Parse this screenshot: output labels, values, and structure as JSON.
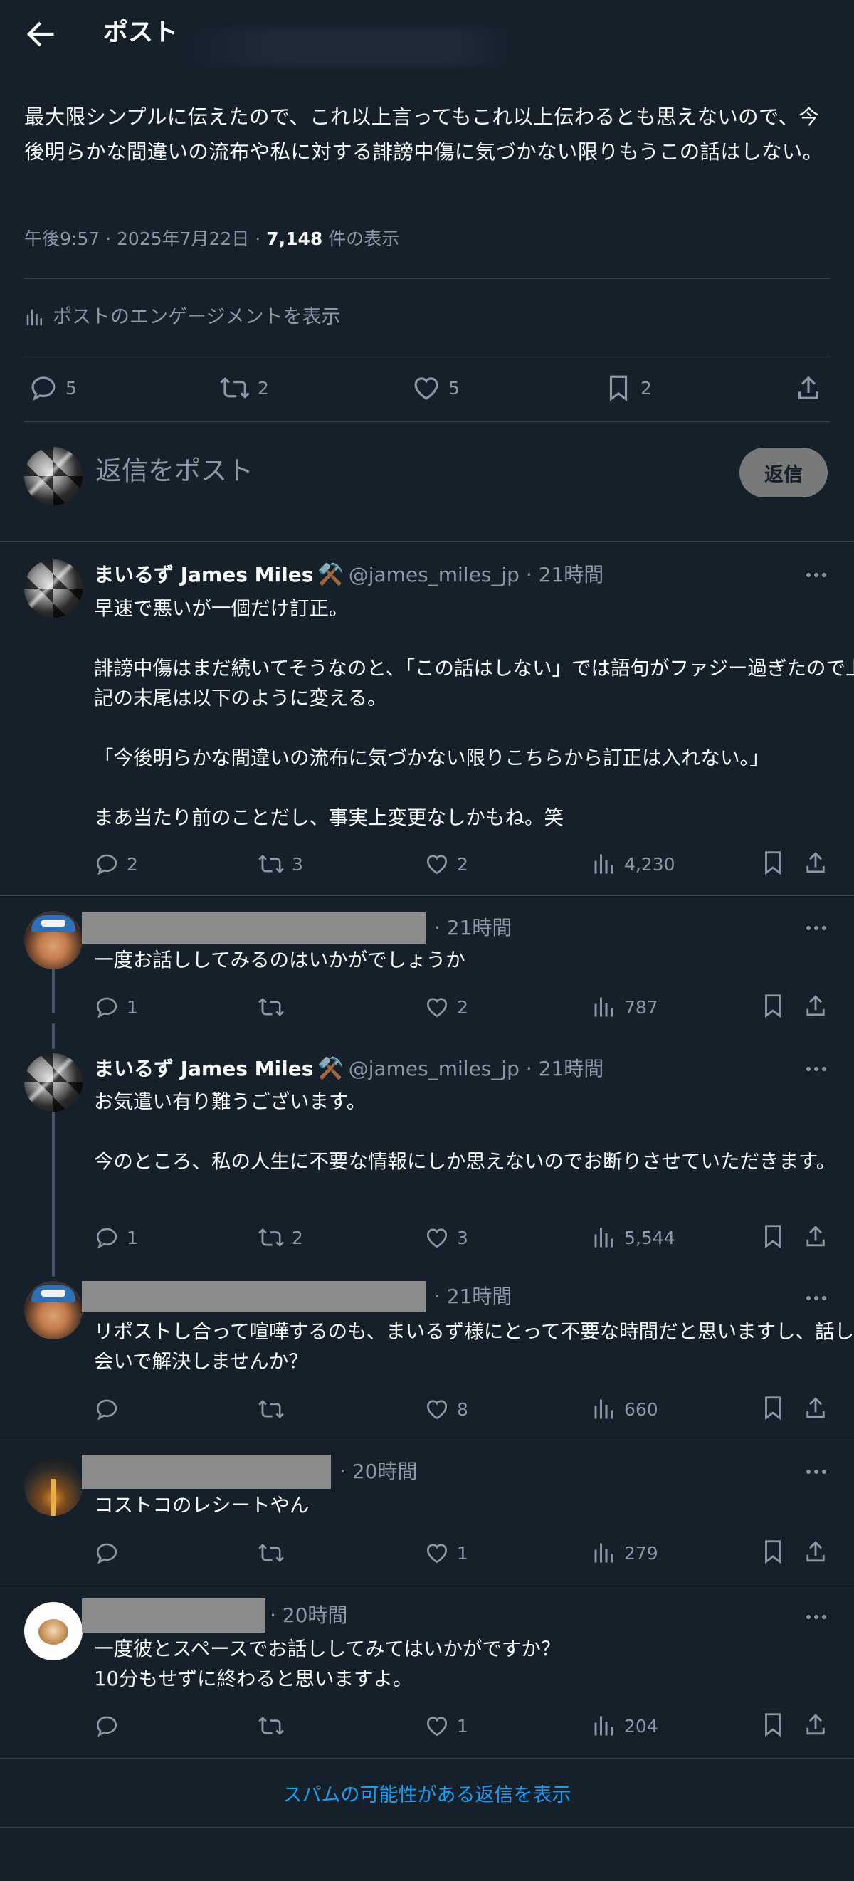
{
  "header": {
    "title": "ポスト"
  },
  "post": {
    "text": "最大限シンプルに伝えたので、これ以上言ってもこれ以上伝わるとも思えないので、今後明らかな間違いの流布や私に対する誹謗中傷に気づかない限りもうこの話はしない。",
    "time": "午後9:57 · 2025年7月22日 · ",
    "views": "7,148",
    "views_label": " 件の表示",
    "engagement_link": "ポストのエンゲージメントを表示",
    "replies": "5",
    "reposts": "2",
    "likes": "5",
    "bookmarks": "2"
  },
  "reply_box": {
    "placeholder": "返信をポスト",
    "button": "返信"
  },
  "replies": [
    {
      "name": "まいるず James Miles",
      "emoji": "⚒️",
      "handle": "@james_miles_jp · 21時間",
      "text": "早速で悪いが一個だけ訂正。\n\n誹謗中傷はまだ続いてそうなのと、「この話はしない」では語句がファジー過ぎたので上記の末尾は以下のように変える。\n\n「今後明らかな間違いの流布に気づかない限りこちらから訂正は入れない。」\n\nまあ当たり前のことだし、事実上変更なしかもね。笑",
      "replies": "2",
      "reposts": "3",
      "likes": "2",
      "views": "4,230"
    },
    {
      "time": "· 21時間",
      "text": "一度お話ししてみるのはいかがでしょうか",
      "replies": "1",
      "reposts": "",
      "likes": "2",
      "views": "787"
    },
    {
      "name": "まいるず James Miles",
      "emoji": "⚒️",
      "handle": "@james_miles_jp · 21時間",
      "text": "お気遣い有り難うございます。\n\n今のところ、私の人生に不要な情報にしか思えないのでお断りさせていただきます。",
      "replies": "1",
      "reposts": "2",
      "likes": "3",
      "views": "5,544"
    },
    {
      "time": "· 21時間",
      "text": "リポストし合って喧嘩するのも、まいるず様にとって不要な時間だと思いますし、話し会いで解決しませんか？",
      "replies": "",
      "reposts": "",
      "likes": "8",
      "views": "660"
    },
    {
      "time": "· 20時間",
      "text": "コストコのレシートやん",
      "replies": "",
      "reposts": "",
      "likes": "1",
      "views": "279"
    },
    {
      "time": "· 20時間",
      "text": "一度彼とスペースでお話ししてみてはいかがですか？\n10分もせずに終わると思いますよ。",
      "replies": "",
      "reposts": "",
      "likes": "1",
      "views": "204"
    }
  ],
  "spam_link": "スパムの可能性がある返信を表示"
}
